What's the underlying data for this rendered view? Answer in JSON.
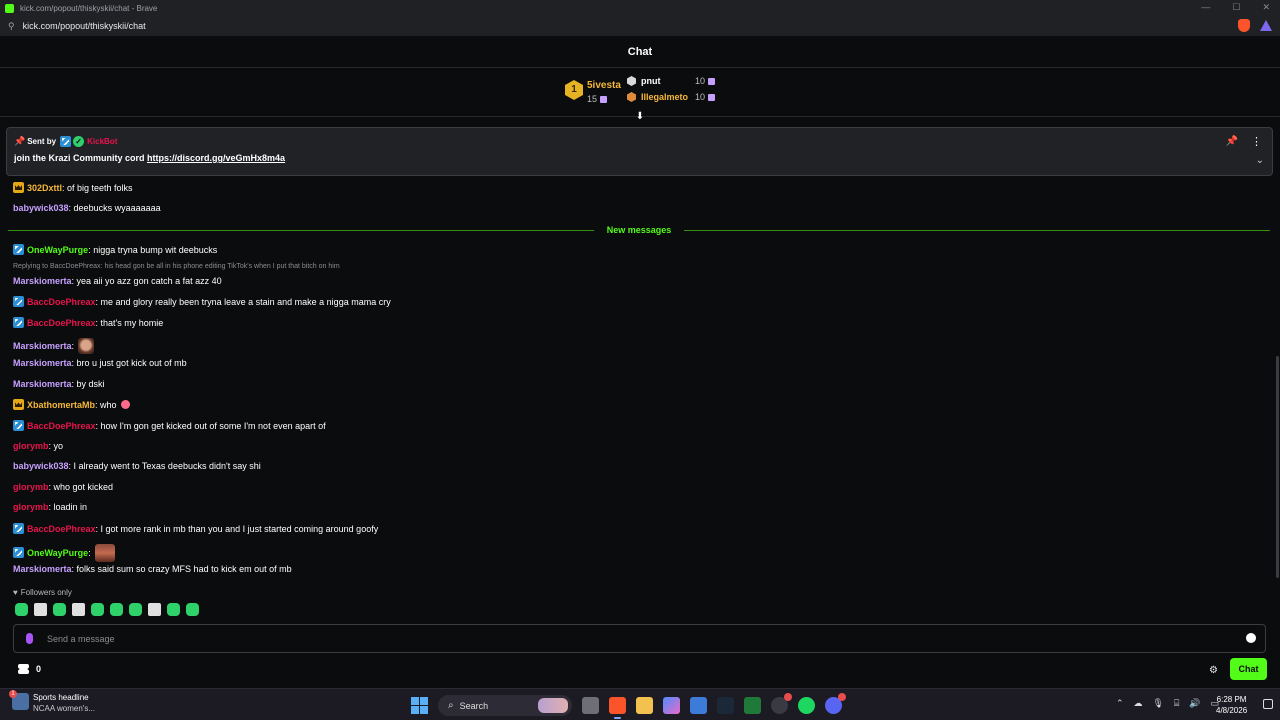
{
  "browser": {
    "window_title": "kick.com/popout/thiskyskii/chat - Brave",
    "url": "kick.com/popout/thiskyskii/chat"
  },
  "chat": {
    "title": "Chat"
  },
  "leaderboard": {
    "first": {
      "rank": "1",
      "name": "5ivesta",
      "count": "15",
      "color": "#f6b73c"
    },
    "others": [
      {
        "name": "pnut",
        "count": "10",
        "color": "#ffffff",
        "hex_color": "#d9d9d9"
      },
      {
        "name": "Illegalmeto",
        "count": "10",
        "color": "#f6b73c",
        "hex_color": "#e08a3c"
      }
    ]
  },
  "pinned": {
    "prefix": "Sent by",
    "sender": "KickBot",
    "message": "join the Krazi Community cord",
    "link": "https://discord.gg/veGmHx8m4a"
  },
  "divider_label": "New messages",
  "messages": [
    {
      "badge": "crown",
      "user": "302Dxttl",
      "color": "#f6b73c",
      "text": ": of big teeth folks",
      "emote": ""
    },
    {
      "badge": "",
      "user": "babywick038",
      "color": "#c6a0ff",
      "text": ": deebucks wyaaaaaaa",
      "emote": ""
    },
    {
      "badge": "vip",
      "user": "OneWayPurge",
      "color": "#53fc18",
      "text": ": nigga tryna bump wit deebucks",
      "emote": ""
    },
    {
      "badge": "",
      "user": "Marskiomerta",
      "color": "#c6a0ff",
      "text": ": yea aii yo azz gon catch a fat azz 40",
      "emote": "",
      "reply": "Replying to BaccDoePhreax: his head gon be all in his phone editing TikTok's when I put that bitch on him"
    },
    {
      "badge": "vip",
      "user": "BaccDoePhreax",
      "color": "#e8144d",
      "text": ": me and glory really been tryna leave a stain and make a nigga mama cry",
      "emote": ""
    },
    {
      "badge": "vip",
      "user": "BaccDoePhreax",
      "color": "#e8144d",
      "text": ": that's my homie",
      "emote": ""
    },
    {
      "badge": "",
      "user": "Marskiomerta",
      "color": "#c6a0ff",
      "text": ":",
      "emote": "face"
    },
    {
      "badge": "",
      "user": "Marskiomerta",
      "color": "#c6a0ff",
      "text": ": bro u just got kick out of mb",
      "emote": ""
    },
    {
      "badge": "",
      "user": "Marskiomerta",
      "color": "#c6a0ff",
      "text": ": by dski",
      "emote": ""
    },
    {
      "badge": "crown",
      "user": "XbathomertaMb",
      "color": "#f6b73c",
      "text": ": who",
      "emote": "smile"
    },
    {
      "badge": "vip",
      "user": "BaccDoePhreax",
      "color": "#e8144d",
      "text": ": how I'm gon get kicked out of some I'm not even apart of",
      "emote": ""
    },
    {
      "badge": "",
      "user": "glorymb",
      "color": "#e8144d",
      "text": ": yo",
      "emote": ""
    },
    {
      "badge": "",
      "user": "babywick038",
      "color": "#c6a0ff",
      "text": ": I already went to Texas deebucks didn't say shi",
      "emote": ""
    },
    {
      "badge": "",
      "user": "glorymb",
      "color": "#e8144d",
      "text": ": who got kicked",
      "emote": ""
    },
    {
      "badge": "",
      "user": "glorymb",
      "color": "#e8144d",
      "text": ": loadin in",
      "emote": ""
    },
    {
      "badge": "vip",
      "user": "BaccDoePhreax",
      "color": "#e8144d",
      "text": ": I got more rank in mb than you and I just started coming around goofy",
      "emote": ""
    },
    {
      "badge": "vip",
      "user": "OneWayPurge",
      "color": "#53fc18",
      "text": ":",
      "emote": "pic"
    },
    {
      "badge": "",
      "user": "Marskiomerta",
      "color": "#c6a0ff",
      "text": ": folks said sum so crazy MFS had to kick em out of mb",
      "emote": ""
    }
  ],
  "footer": {
    "followers_only": "Followers only",
    "input_placeholder": "Send a message",
    "points": "0",
    "send_label": "Chat"
  },
  "taskbar": {
    "news_title": "Sports headline",
    "news_sub": "NCAA women's...",
    "news_badge": "1",
    "search_label": "Search",
    "time": "6:28 PM",
    "date": "4/8/2026"
  }
}
